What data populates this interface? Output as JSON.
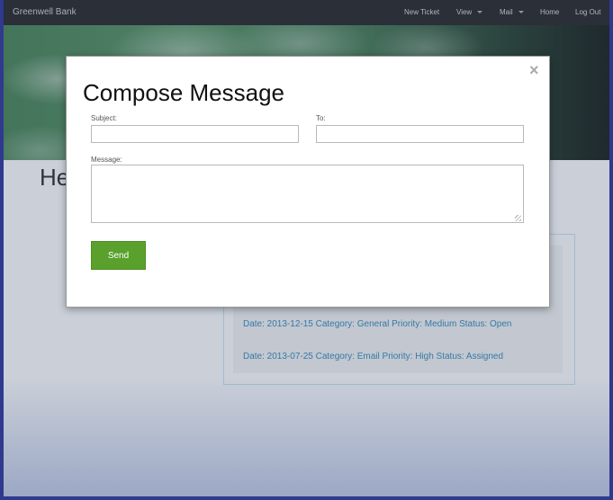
{
  "navbar": {
    "brand": "Greenwell Bank",
    "items": [
      {
        "label": "New Ticket"
      },
      {
        "label": "View",
        "dropdown": true
      },
      {
        "label": "Mail",
        "dropdown": true
      },
      {
        "label": "Home"
      },
      {
        "label": "Log Out"
      }
    ]
  },
  "page": {
    "heading": "He",
    "tickets": [
      "Date: 2013-12-15 Category: General Priority: Medium Status: Open",
      "Date: 2013-07-25 Category: Email Priority: High Status: Assigned"
    ]
  },
  "modal": {
    "title": "Compose Message",
    "close_symbol": "×",
    "subject_label": "Subject:",
    "subject_value": "",
    "to_label": "To:",
    "to_value": "",
    "message_label": "Message:",
    "message_value": "",
    "send_label": "Send"
  },
  "colors": {
    "navbar": "#1b1b1b",
    "send_button": "#5aa02c",
    "link": "#2a86b5",
    "frame": "#2f3a8e"
  }
}
